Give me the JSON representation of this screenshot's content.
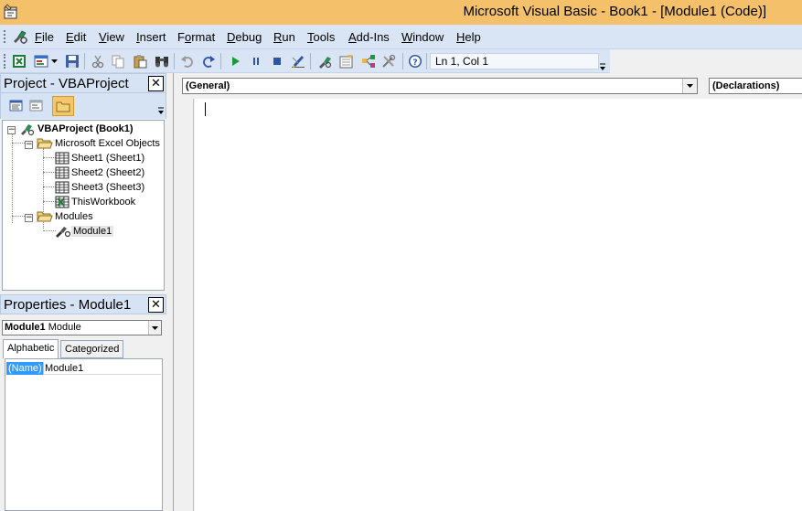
{
  "window": {
    "title": "Microsoft Visual Basic - Book1 - [Module1 (Code)]",
    "title_bar_color": "#f4c06a",
    "app_icon": "vba-editor-icon"
  },
  "menu": {
    "items": [
      {
        "label": "File",
        "underline": "F"
      },
      {
        "label": "Edit",
        "underline": "E"
      },
      {
        "label": "View",
        "underline": "V"
      },
      {
        "label": "Insert",
        "underline": "I"
      },
      {
        "label": "Format",
        "underline": "o"
      },
      {
        "label": "Debug",
        "underline": "D"
      },
      {
        "label": "Run",
        "underline": "R"
      },
      {
        "label": "Tools",
        "underline": "T"
      },
      {
        "label": "Add-Ins",
        "underline": "A"
      },
      {
        "label": "Window",
        "underline": "W"
      },
      {
        "label": "Help",
        "underline": "H"
      }
    ]
  },
  "toolbar": {
    "buttons": [
      "view-excel-icon",
      "insert-userform-icon",
      "save-icon",
      "cut-icon",
      "copy-icon",
      "paste-icon",
      "find-icon",
      "undo-icon",
      "redo-icon",
      "run-icon",
      "break-icon",
      "reset-icon",
      "design-mode-icon",
      "project-explorer-icon",
      "properties-window-icon",
      "object-browser-icon",
      "toolbox-icon",
      "help-icon"
    ],
    "position_status": "Ln 1, Col 1"
  },
  "project_panel": {
    "title": "Project - VBAProject",
    "close": "✕",
    "toolbar_buttons": [
      "view-code-icon",
      "view-object-icon",
      "toggle-folders-icon"
    ],
    "tree": {
      "root": {
        "label": "VBAProject (Book1)"
      },
      "excel_objects": {
        "label": "Microsoft Excel Objects"
      },
      "sheet1": {
        "label": "Sheet1 (Sheet1)"
      },
      "sheet2": {
        "label": "Sheet2 (Sheet2)"
      },
      "sheet3": {
        "label": "Sheet3 (Sheet3)"
      },
      "thisworkbook": {
        "label": "ThisWorkbook"
      },
      "modules": {
        "label": "Modules"
      },
      "module1": {
        "label": "Module1"
      }
    }
  },
  "properties_panel": {
    "title": "Properties - Module1",
    "close": "✕",
    "object_name": "Module1",
    "object_type": "Module",
    "tabs": [
      "Alphabetic",
      "Categorized"
    ],
    "active_tab": "Alphabetic",
    "rows": [
      {
        "name": "(Name)",
        "value": "Module1"
      }
    ]
  },
  "code_window": {
    "object_combo": "(General)",
    "procedure_combo": "(Declarations)",
    "code": ""
  }
}
